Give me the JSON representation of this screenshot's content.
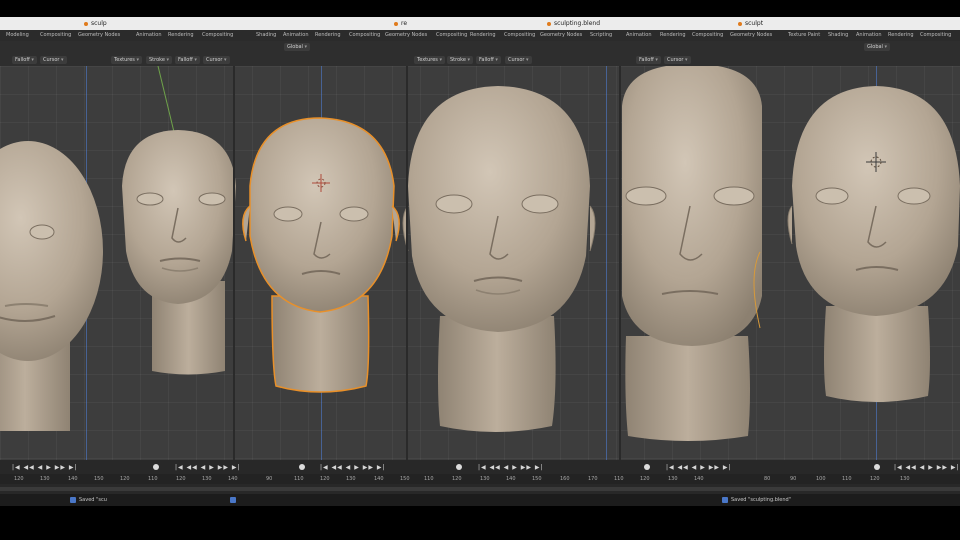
{
  "window_titles": [
    "sculp",
    "re",
    "sculpting.blend",
    "sculpt"
  ],
  "workspace_tabs_left": [
    "Modeling",
    "Compositing",
    "Geometry Nodes",
    "Shading",
    "Animation",
    "Rendering",
    "Compositing",
    "Compositing",
    "Shading",
    "Animation",
    "Rendering",
    "Compositing",
    "Geometry Nodes",
    "Compositing",
    "Geometry Nodes",
    "Rendering",
    "Scripting"
  ],
  "workspace_tabs_right": [
    "Animation",
    "Rendering",
    "Compositing",
    "Geometry Nodes",
    "Texture Paint",
    "Shading",
    "Animation",
    "Rendering",
    "Compositing"
  ],
  "header": {
    "mode_label": "Global",
    "dropdowns_a": [
      "Falloff",
      "Cursor"
    ],
    "dropdowns_b": [
      "Textures",
      "Stroke",
      "Falloff",
      "Cursor"
    ],
    "dropdowns_c": [
      "Textures",
      "Stroke",
      "Falloff",
      "Cursor"
    ],
    "dropdowns_d": [
      "Falloff",
      "Cursor"
    ]
  },
  "timeline": {
    "ticks": [
      "120",
      "130",
      "140",
      "150",
      "120",
      "110",
      "120",
      "130",
      "140",
      "90",
      "110",
      "120",
      "130",
      "140",
      "150",
      "110",
      "120",
      "130",
      "140",
      "150",
      "160",
      "170",
      "110",
      "120",
      "130",
      "140",
      "80",
      "90",
      "100",
      "110",
      "120",
      "130"
    ]
  },
  "status": {
    "left": "Saved \"scu",
    "right": "Saved \"sculpting.blend\""
  },
  "colors": {
    "viewport_bg": "#3d3d3d",
    "clay": "#bcae9d",
    "selection_outline": "#e8902a",
    "axis_blue": "#4a77c8"
  }
}
